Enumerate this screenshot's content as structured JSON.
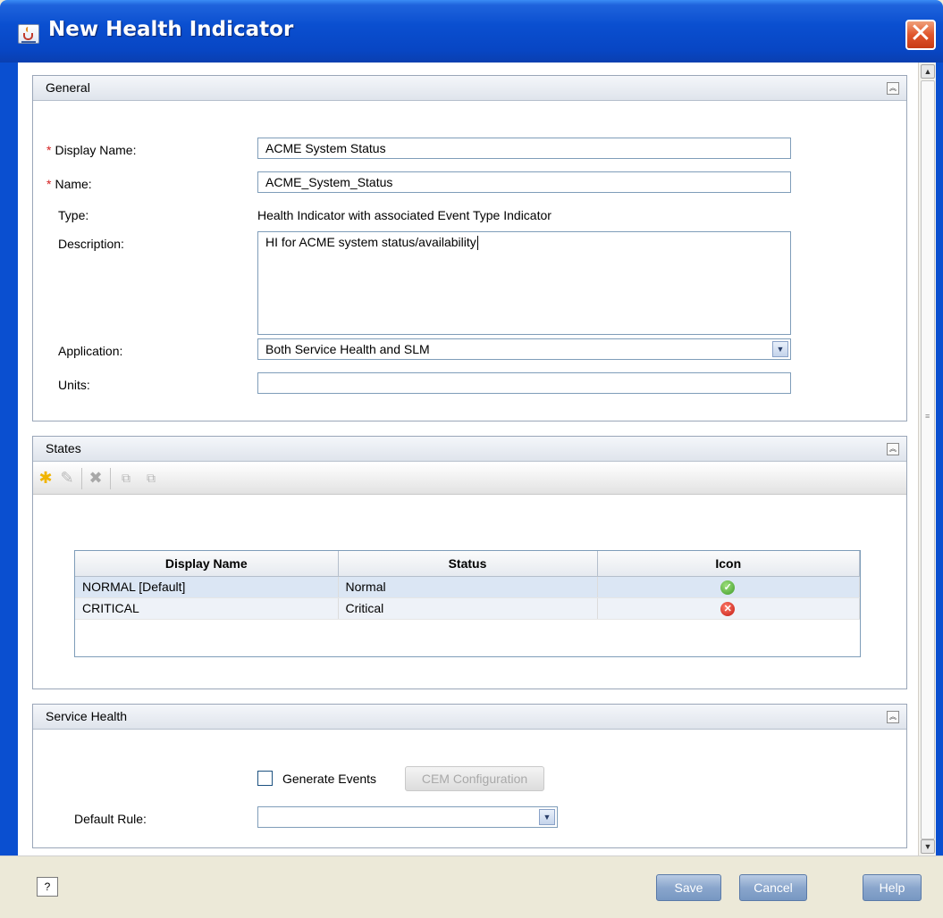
{
  "window": {
    "title": "New Health Indicator",
    "close_glyph": "✕"
  },
  "general": {
    "header": "General",
    "display_name_label": "Display Name:",
    "display_name_value": "ACME System Status",
    "name_label": "Name:",
    "name_value": "ACME_System_Status",
    "type_label": "Type:",
    "type_value": "Health Indicator with associated Event Type Indicator",
    "description_label": "Description:",
    "description_value": "HI for ACME system status/availability",
    "application_label": "Application:",
    "application_value": "Both Service Health and SLM",
    "units_label": "Units:",
    "units_value": "",
    "required_marker": "*"
  },
  "states": {
    "header": "States",
    "columns": [
      "Display Name",
      "Status",
      "Icon"
    ],
    "rows": [
      {
        "display_name": "NORMAL [Default]",
        "status": "Normal",
        "icon": "check-circle-icon"
      },
      {
        "display_name": "CRITICAL",
        "status": "Critical",
        "icon": "error-circle-icon"
      }
    ],
    "toolbar_icons": [
      "new-icon",
      "edit-icon",
      "delete-icon",
      "move-up-icon",
      "move-down-icon"
    ]
  },
  "service_health": {
    "header": "Service Health",
    "generate_events_label": "Generate Events",
    "generate_events_checked": false,
    "cem_button_label": "CEM Configuration",
    "default_rule_label": "Default Rule:",
    "default_rule_value": ""
  },
  "footer": {
    "save_label": "Save",
    "cancel_label": "Cancel",
    "help_label": "Help",
    "help_icon_glyph": "?",
    "help_icon": "context-help-icon"
  },
  "colors": {
    "titlebar": "#0a4fd0",
    "required": "#d32020",
    "button": "#8aa6cc"
  }
}
